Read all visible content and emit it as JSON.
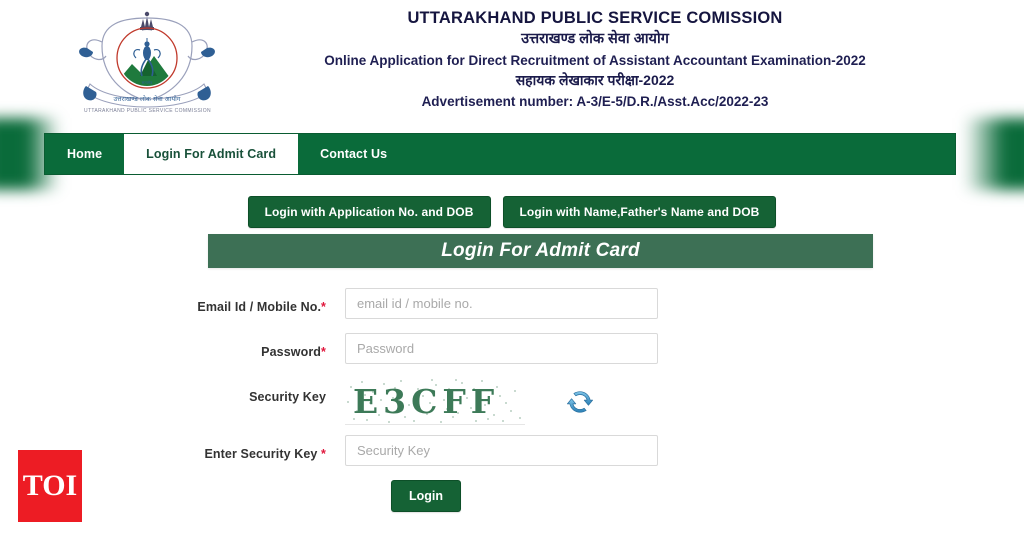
{
  "site": {
    "logo_caption": "UTTARAKHAND PUBLIC SERVICE COMMISSION",
    "emblem_icon": "uttarakhand-psc-emblem-icon"
  },
  "header": {
    "line1": "UTTARAKHAND PUBLIC SERVICE COMISSION",
    "line2": "उत्तराखण्ड लोक सेवा आयोग",
    "line3": "Online Application for Direct Recruitment of Assistant Accountant Examination-2022",
    "line4": "सहायक लेखाकार परीक्षा-2022",
    "line5": "Advertisement number: A-3/E-5/D.R./Asst.Acc/2022-23"
  },
  "nav": {
    "items": [
      {
        "label": "Home",
        "active": false
      },
      {
        "label": "Login For Admit Card",
        "active": true
      },
      {
        "label": "Contact Us",
        "active": false
      }
    ]
  },
  "login_modes": [
    {
      "label": "Login with Application No. and DOB"
    },
    {
      "label": "Login with Name,Father's Name and DOB"
    }
  ],
  "panel": {
    "title": "Login For Admit Card"
  },
  "form": {
    "email": {
      "label": "Email Id / Mobile No.",
      "required_mark": "*",
      "placeholder": "email id / mobile no.",
      "value": ""
    },
    "password": {
      "label": "Password",
      "required_mark": "*",
      "placeholder": "Password",
      "value": ""
    },
    "security_key": {
      "label": "Security Key",
      "captcha_text": "E3CFF",
      "refresh_icon": "refresh-icon"
    },
    "enter_security_key": {
      "label": "Enter Security Key",
      "required_mark": "*",
      "placeholder": "Security Key",
      "value": ""
    },
    "submit_label": "Login"
  },
  "watermark": {
    "label": "TOI"
  },
  "colors": {
    "nav_green": "#0a6b3a",
    "button_green": "#156235",
    "panel_green": "#3d7055",
    "heading_navy": "#1b1b4b",
    "required_red": "#e0173c",
    "captcha_green": "#3d7a58",
    "watermark_red": "#ed1c24"
  }
}
